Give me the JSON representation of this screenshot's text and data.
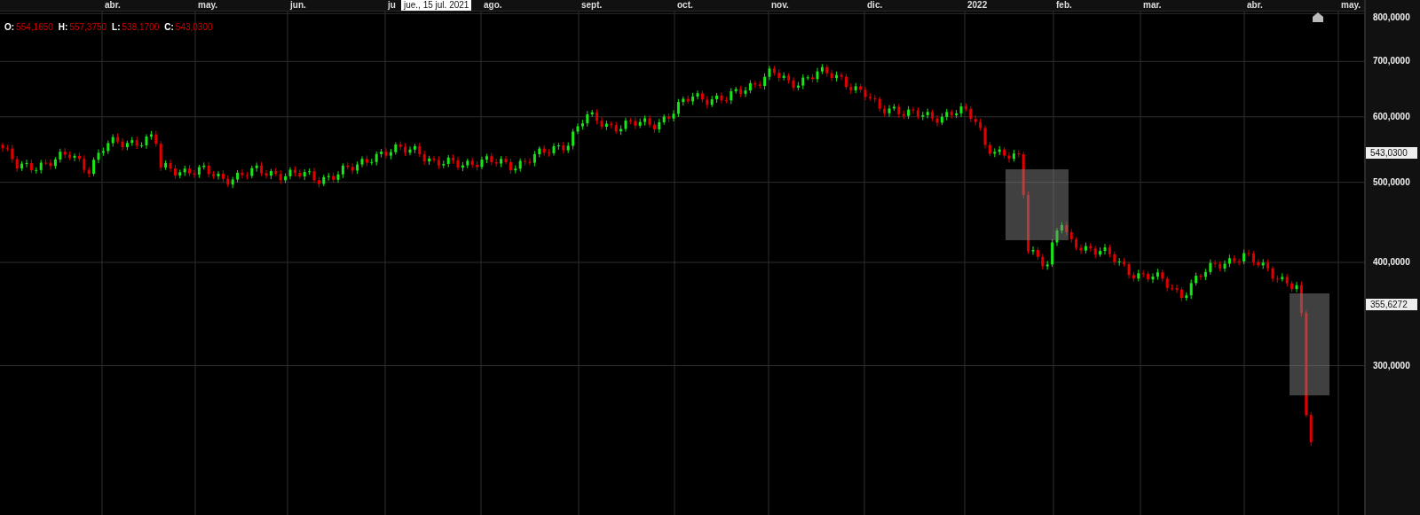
{
  "time_axis": {
    "labels": [
      "abr.",
      "may.",
      "jun.",
      "ju",
      "ago.",
      "sept.",
      "oct.",
      "nov.",
      "dic.",
      "2022",
      "feb.",
      "mar.",
      "abr.",
      "may."
    ]
  },
  "crosshair_tooltip": "jue., 15 jul. 2021",
  "ohlc": [
    {
      "label": "O:",
      "value": "554,1650"
    },
    {
      "label": "H:",
      "value": "557,3750"
    },
    {
      "label": "L:",
      "value": "538,1700"
    },
    {
      "label": "C:",
      "value": "543,0300"
    }
  ],
  "price_axis": {
    "ticks": [
      "800,0000",
      "700,0000",
      "600,0000",
      "500,0000",
      "400,0000",
      "300,0000"
    ],
    "tags": [
      "543,0300",
      "355,6272"
    ]
  }
}
